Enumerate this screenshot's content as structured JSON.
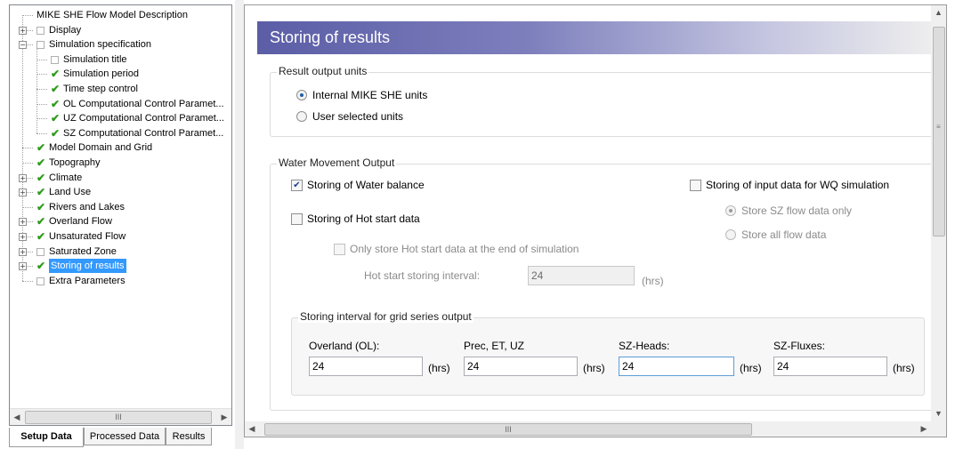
{
  "tree": {
    "items": [
      {
        "label": "MIKE SHE Flow Model Description",
        "level": 0,
        "icon": "none",
        "expander": "none"
      },
      {
        "label": "Display",
        "level": 0,
        "icon": "empty-box-icon",
        "expander": "plus"
      },
      {
        "label": "Simulation specification",
        "level": 0,
        "icon": "empty-box-icon",
        "expander": "minus"
      },
      {
        "label": "Simulation title",
        "level": 1,
        "icon": "empty-box-icon",
        "expander": "none"
      },
      {
        "label": "Simulation period",
        "level": 1,
        "icon": "green-check-icon",
        "expander": "none"
      },
      {
        "label": "Time step control",
        "level": 1,
        "icon": "green-check-icon",
        "expander": "none"
      },
      {
        "label": "OL Computational Control Paramet...",
        "level": 1,
        "icon": "green-check-icon",
        "expander": "none"
      },
      {
        "label": "UZ Computational Control Paramet...",
        "level": 1,
        "icon": "green-check-icon",
        "expander": "none"
      },
      {
        "label": "SZ Computational Control Paramet...",
        "level": 1,
        "icon": "green-check-icon",
        "expander": "none"
      },
      {
        "label": "Model Domain and Grid",
        "level": 0,
        "icon": "green-check-icon",
        "expander": "none"
      },
      {
        "label": "Topography",
        "level": 0,
        "icon": "green-check-icon",
        "expander": "none"
      },
      {
        "label": "Climate",
        "level": 0,
        "icon": "green-check-icon",
        "expander": "plus"
      },
      {
        "label": "Land Use",
        "level": 0,
        "icon": "green-check-icon",
        "expander": "plus"
      },
      {
        "label": "Rivers and Lakes",
        "level": 0,
        "icon": "green-check-icon",
        "expander": "none"
      },
      {
        "label": "Overland Flow",
        "level": 0,
        "icon": "green-check-icon",
        "expander": "plus"
      },
      {
        "label": "Unsaturated Flow",
        "level": 0,
        "icon": "green-check-icon",
        "expander": "plus"
      },
      {
        "label": "Saturated Zone",
        "level": 0,
        "icon": "empty-box-icon",
        "expander": "plus"
      },
      {
        "label": "Storing of results",
        "level": 0,
        "icon": "green-check-icon",
        "expander": "plus",
        "selected": true
      },
      {
        "label": "Extra Parameters",
        "level": 0,
        "icon": "empty-box-icon",
        "expander": "none"
      }
    ],
    "hscroll_thumb": "III"
  },
  "tabs": [
    {
      "label": "Setup Data",
      "active": true
    },
    {
      "label": "Processed Data",
      "active": false
    },
    {
      "label": "Results",
      "active": false
    }
  ],
  "page": {
    "title": "Storing of results",
    "hscroll_thumb": "III",
    "vscroll_grip": "≡"
  },
  "units_group": {
    "legend": "Result output units",
    "options": [
      {
        "label": "Internal MIKE SHE units",
        "selected": true
      },
      {
        "label": "User selected units",
        "selected": false
      }
    ]
  },
  "water_group": {
    "legend": "Water Movement Output",
    "water_balance": {
      "label": "Storing of Water balance",
      "checked": true
    },
    "hot_start": {
      "label": "Storing of Hot start data",
      "checked": false
    },
    "hot_start_end": {
      "label": "Only store Hot start data at the end of simulation",
      "checked": false
    },
    "hot_interval": {
      "label": "Hot start storing interval:",
      "value": "24",
      "unit": "(hrs)"
    },
    "wq_input": {
      "label": "Storing of input data for WQ simulation",
      "checked": false
    },
    "wq_options": [
      {
        "label": "Store SZ flow data only",
        "selected": true
      },
      {
        "label": "Store all flow data",
        "selected": false
      }
    ]
  },
  "interval_group": {
    "legend": "Storing interval for grid series output",
    "fields": [
      {
        "label": "Overland (OL):",
        "value": "24",
        "unit": "(hrs)"
      },
      {
        "label": "Prec, ET, UZ",
        "value": "24",
        "unit": "(hrs)"
      },
      {
        "label": "SZ-Heads:",
        "value": "24",
        "unit": "(hrs)"
      },
      {
        "label": "SZ-Fluxes:",
        "value": "24",
        "unit": "(hrs)"
      }
    ]
  }
}
